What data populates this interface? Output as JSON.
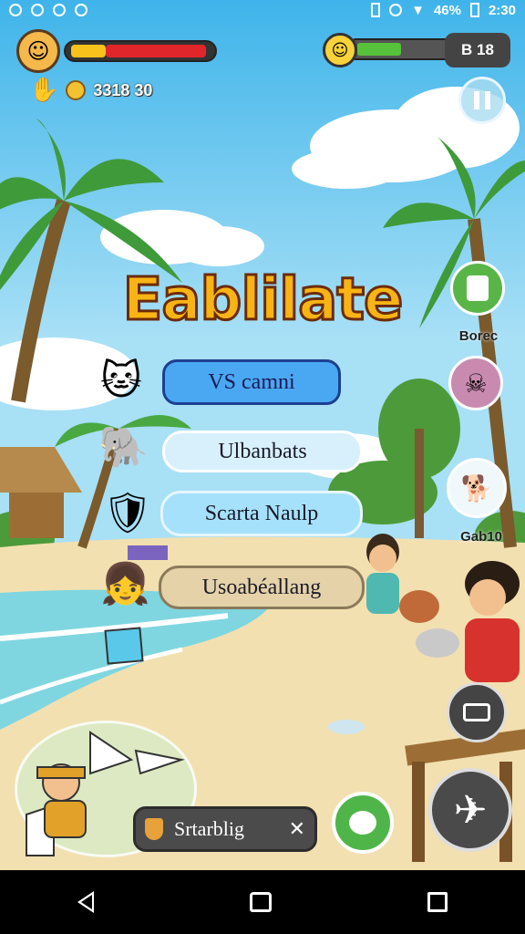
{
  "status_bar": {
    "battery": "46%",
    "time": "2:30",
    "left_icons": [
      "circle-icon",
      "circle-icon",
      "circle-icon",
      "circle-icon"
    ],
    "right_icons": [
      "sim-icon",
      "network-icon",
      "sync-icon",
      "wifi-icon",
      "battery-icon"
    ]
  },
  "hud": {
    "health_fraction": 0.9,
    "coins": "3318 30",
    "energy_fraction": 0.35,
    "energy_count": "B 18",
    "pause_icon": "pause-icon"
  },
  "game_title": "Eablilate",
  "menu": {
    "items": [
      {
        "label": "VS camni",
        "icon": "cat-icon"
      },
      {
        "label": "Ulbanbats",
        "icon": "elephant-icon"
      },
      {
        "label": "Scarta Naulp",
        "icon": "shield-icon"
      },
      {
        "label": "Usoabéallang",
        "icon": "girl-icon"
      }
    ]
  },
  "side": {
    "store_label": "Borec",
    "profile_label": "Gab10"
  },
  "chat": {
    "text": "Srtarblig",
    "close": "✕"
  },
  "colors": {
    "sky": "#6fc6ee",
    "sand": "#f3e0b0",
    "sea": "#7fd6e0",
    "title": "#f8b415",
    "button_primary": "#4aa8f2"
  }
}
